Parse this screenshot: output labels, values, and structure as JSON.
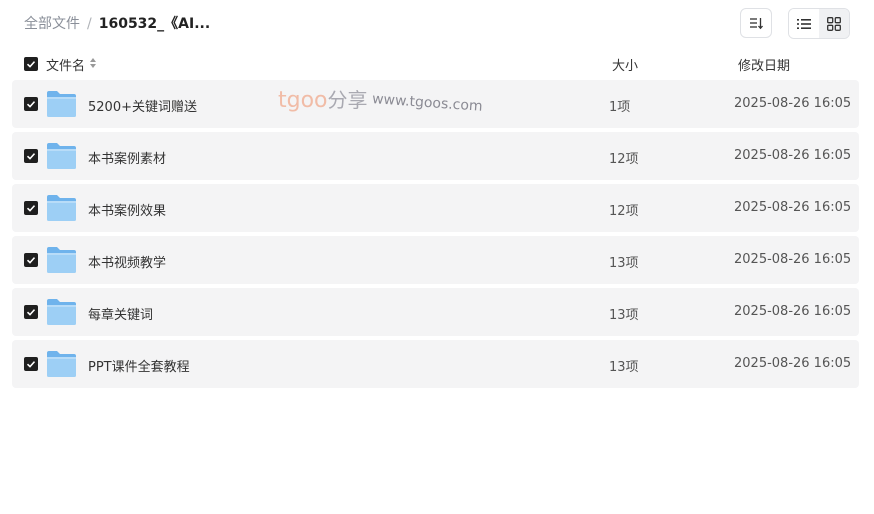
{
  "breadcrumb": {
    "root": "全部文件",
    "separator": "/",
    "current": "160532_《AI..."
  },
  "toolbar": {
    "sort_icon": "sort-icon",
    "list_view_icon": "list-view-icon",
    "grid_view_icon": "grid-view-icon"
  },
  "columns": {
    "name": "文件名",
    "size": "大小",
    "date": "修改日期"
  },
  "watermark": {
    "brand": "tgoo",
    "cn": "分享",
    "url": "www.tgoos.com"
  },
  "files": [
    {
      "name": "5200+关键词赠送",
      "size": "1项",
      "date": "2025-08-26 16:05",
      "checked": true
    },
    {
      "name": "本书案例素材",
      "size": "12项",
      "date": "2025-08-26 16:05",
      "checked": true
    },
    {
      "name": "本书案例效果",
      "size": "12项",
      "date": "2025-08-26 16:05",
      "checked": true
    },
    {
      "name": "本书视频教学",
      "size": "13项",
      "date": "2025-08-26 16:05",
      "checked": true
    },
    {
      "name": "每章关键词",
      "size": "13项",
      "date": "2025-08-26 16:05",
      "checked": true
    },
    {
      "name": "PPT课件全套教程",
      "size": "13项",
      "date": "2025-08-26 16:05",
      "checked": true
    }
  ],
  "colors": {
    "row_bg": "#f4f4f5",
    "checkbox": "#1f1f1f",
    "folder": "#8cc4f2"
  }
}
